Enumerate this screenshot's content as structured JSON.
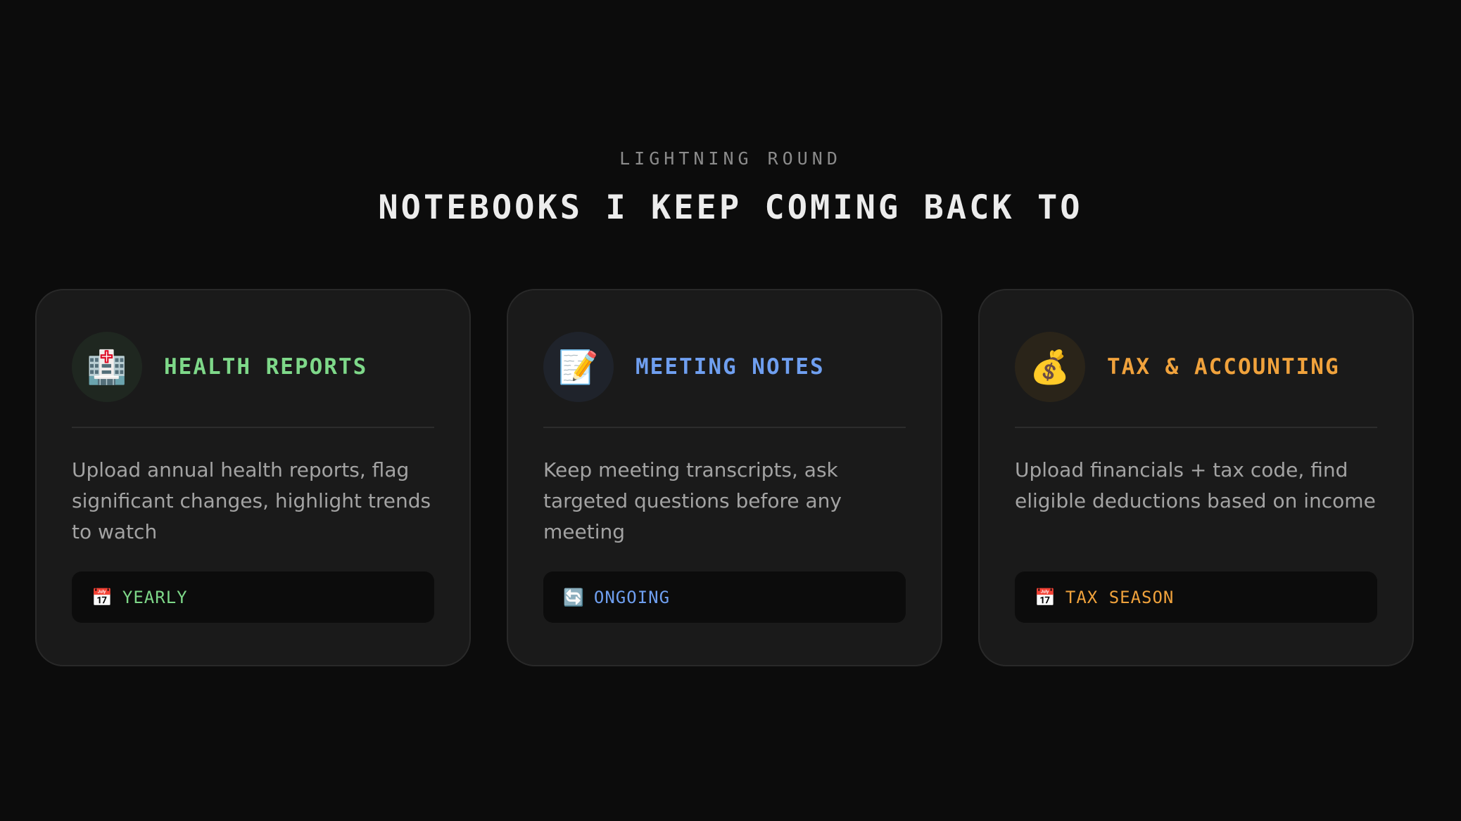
{
  "header": {
    "eyebrow": "LIGHTNING ROUND",
    "title": "NOTEBOOKS I KEEP COMING BACK TO"
  },
  "cards": [
    {
      "title": "HEALTH REPORTS",
      "icon": "hospital-icon",
      "icon_glyph": "🏥",
      "accent": "#7ed889",
      "icon_bg": "#1f2720",
      "description": "Upload annual health reports, flag significant changes, highlight trends to watch",
      "tag": {
        "icon": "calendar-icon",
        "glyph": "📅",
        "label": "YEARLY"
      }
    },
    {
      "title": "MEETING NOTES",
      "icon": "memo-icon",
      "icon_glyph": "📝",
      "accent": "#6f9ff0",
      "icon_bg": "#1f232b",
      "description": "Keep meeting transcripts, ask targeted questions before any meeting",
      "tag": {
        "icon": "refresh-icon",
        "glyph": "🔄",
        "label": "ONGOING"
      }
    },
    {
      "title": "TAX & ACCOUNTING",
      "icon": "money-bag-icon",
      "icon_glyph": "💰",
      "accent": "#f0a23c",
      "icon_bg": "#2a2419",
      "description": "Upload financials + tax code, find eligible deductions based on income",
      "tag": {
        "icon": "calendar-icon",
        "glyph": "📅",
        "label": "TAX SEASON"
      }
    }
  ]
}
